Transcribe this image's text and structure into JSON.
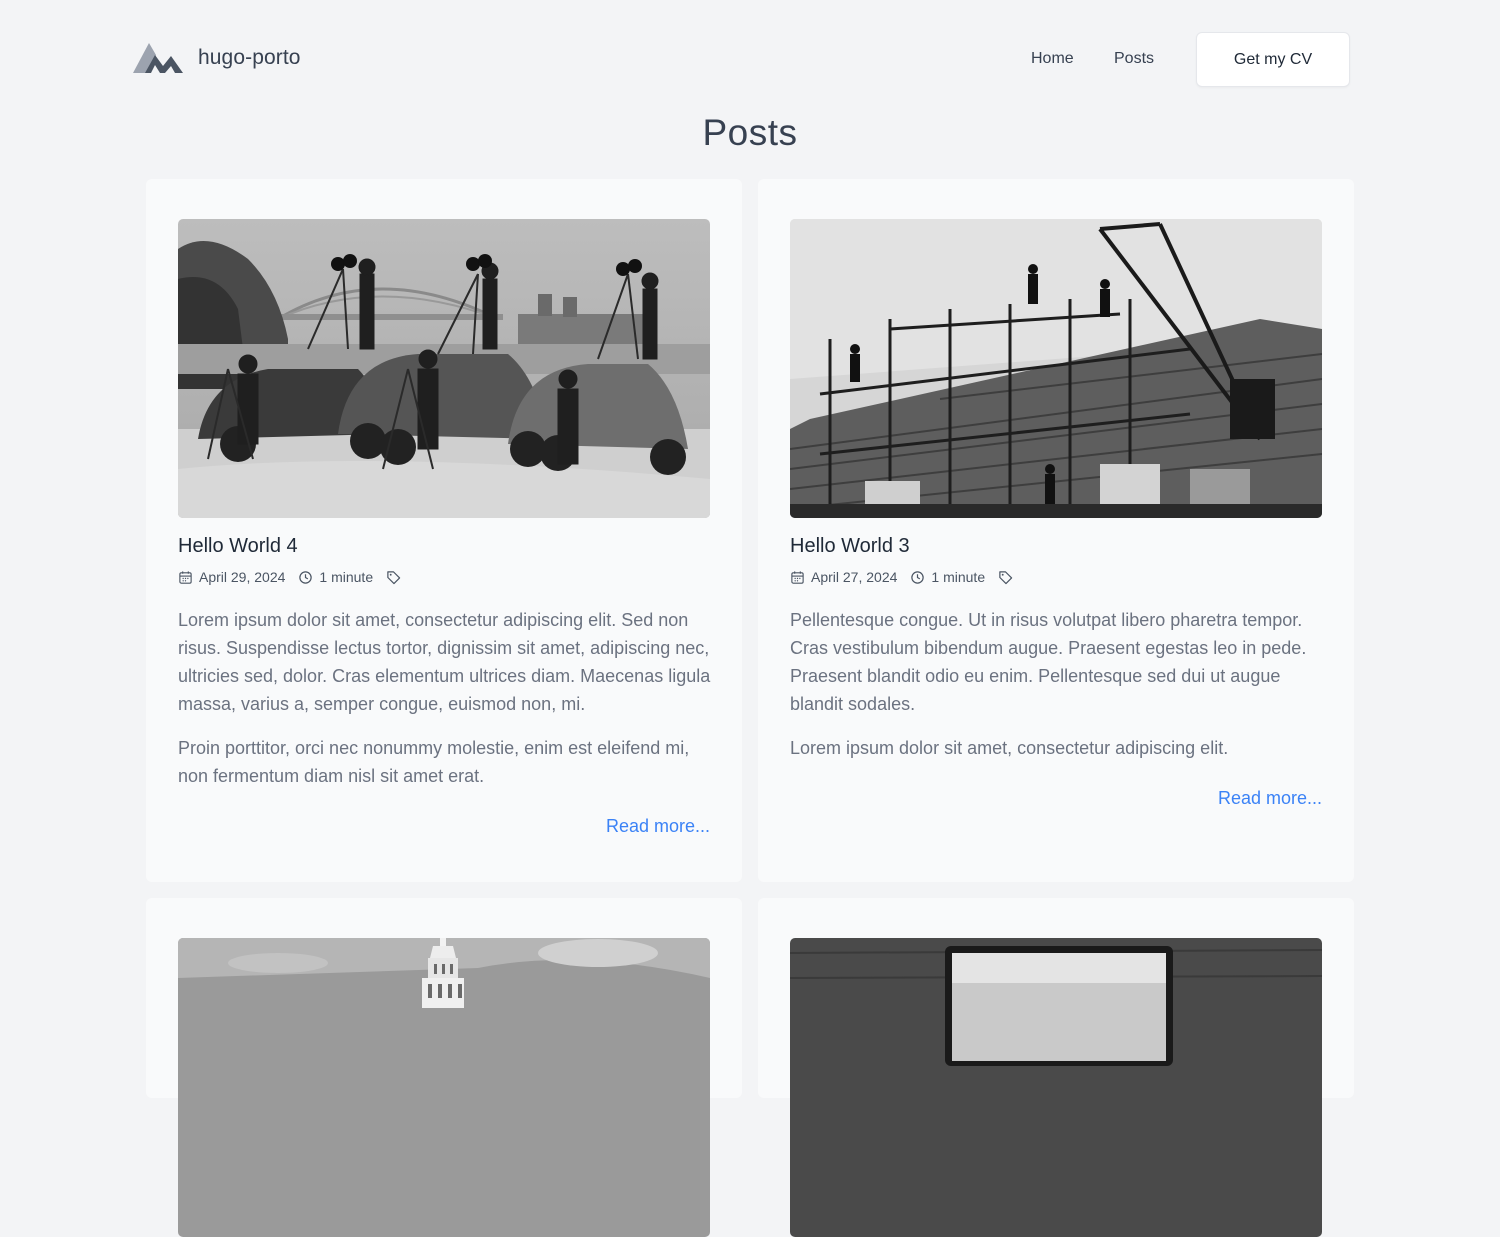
{
  "site": {
    "name": "hugo-porto",
    "nav": {
      "home": "Home",
      "posts": "Posts",
      "cv_button": "Get my CV"
    }
  },
  "page_title": "Posts",
  "posts": [
    {
      "title": "Hello World 4",
      "date": "April 29, 2024",
      "reading_time": "1 minute",
      "image_icon": "photo-cameramen-cars",
      "excerpt": [
        "Lorem ipsum dolor sit amet, consectetur adipiscing elit. Sed non risus. Suspendisse lectus tortor, dignissim sit amet, adipiscing nec, ultricies sed, dolor. Cras elementum ultrices diam. Maecenas ligula massa, varius a, semper congue, euismod non, mi.",
        "Proin porttitor, orci nec nonummy molestie, enim est eleifend mi, non fermentum diam nisl sit amet erat."
      ],
      "read_more": "Read more..."
    },
    {
      "title": "Hello World 3",
      "date": "April 27, 2024",
      "reading_time": "1 minute",
      "image_icon": "photo-construction-site",
      "excerpt": [
        "Pellentesque congue. Ut in risus volutpat libero pharetra tempor. Cras vestibulum bibendum augue. Praesent egestas leo in pede. Praesent blandit odio eu enim. Pellentesque sed dui ut augue blandit sodales.",
        "Lorem ipsum dolor sit amet, consectetur adipiscing elit."
      ],
      "read_more": "Read more..."
    }
  ],
  "colors": {
    "background": "#f3f4f6",
    "card": "#f9fafb",
    "link": "#3b82f6",
    "text": "#374151",
    "muted": "#6b7280"
  }
}
